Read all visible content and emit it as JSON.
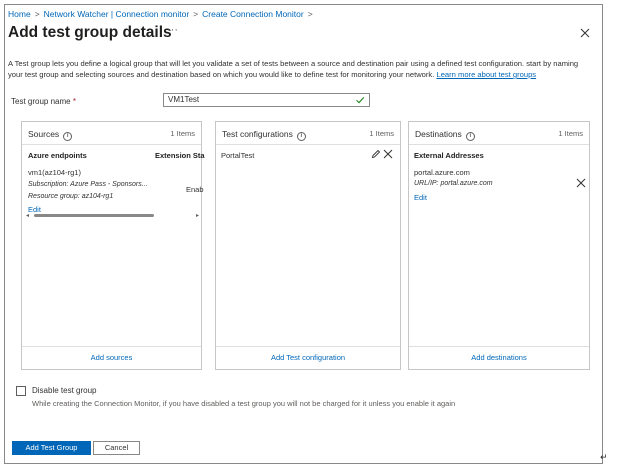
{
  "breadcrumb": {
    "items": [
      "Home",
      "Network Watcher | Connection monitor",
      "Create Connection Monitor"
    ],
    "separator": ">"
  },
  "header": {
    "title": "Add test group details",
    "more_label": "···"
  },
  "description": {
    "text": "A Test group lets you define a logical group that will let you validate a set of tests between a source and destination pair using a defined test configuration. start by naming your test group and selecting sources and destination based on which you would like to define test for monitoring your network.",
    "link": "Learn more about test groups"
  },
  "test_group_name": {
    "label": "Test group name",
    "required_mark": "*",
    "value": "VM1Test"
  },
  "sources": {
    "title": "Sources",
    "count": "1 Items",
    "col_endpoints": "Azure endpoints",
    "col_extension": "Extension Sta",
    "vm_name": "vm1(az104-rg1)",
    "subscription": "Subscription: Azure Pass - Sponsors...",
    "resource_group": "Resource group: az104-rg1",
    "extension_status": "Enab",
    "edit": "Edit",
    "add": "Add sources"
  },
  "test_configurations": {
    "title": "Test configurations",
    "count": "1 Items",
    "item": "PortalTest",
    "add": "Add Test configuration"
  },
  "destinations": {
    "title": "Destinations",
    "count": "1 Items",
    "col_head": "External Addresses",
    "address": "portal.azure.com",
    "url_ip": "URL/IP: portal.azure.com",
    "edit": "Edit",
    "add": "Add destinations"
  },
  "disable": {
    "label": "Disable test group",
    "description": "While creating the Connection Monitor, if you have disabled a test group you will not be charged for it unless you enable it again"
  },
  "buttons": {
    "add": "Add Test Group",
    "cancel": "Cancel"
  },
  "colors": {
    "accent": "#0067b8",
    "text": "#323130",
    "border": "#c8c6c4",
    "success": "#107c10"
  }
}
